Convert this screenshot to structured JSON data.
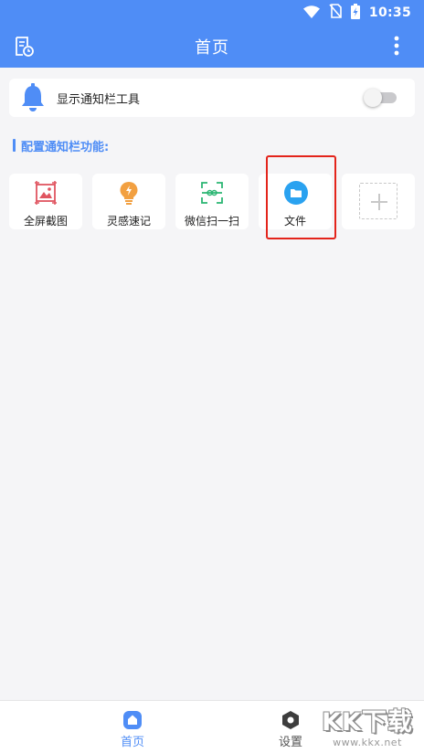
{
  "status_bar": {
    "time": "10:35",
    "icons": [
      "wifi-icon",
      "no-sim-icon",
      "battery-charging-icon"
    ]
  },
  "app_bar": {
    "title": "首页",
    "left_icon": "notes-clock-icon",
    "right_icon": "more-vertical-icon"
  },
  "notification_toggle": {
    "icon": "bell-icon",
    "label": "显示通知栏工具",
    "enabled": false
  },
  "section": {
    "title": "配置通知栏功能:"
  },
  "tools": [
    {
      "label": "全屏截图",
      "icon": "screenshot-image-icon",
      "color": "#e05560"
    },
    {
      "label": "灵感速记",
      "icon": "lightbulb-icon",
      "color": "#f2a041"
    },
    {
      "label": "微信扫一扫",
      "icon": "scan-icon",
      "color": "#2bb673"
    },
    {
      "label": "文件",
      "icon": "folder-icon",
      "color": "#2aa2f0"
    }
  ],
  "add_tool": {
    "icon": "plus-icon"
  },
  "bottom_nav": [
    {
      "label": "首页",
      "icon": "home-icon",
      "active": true
    },
    {
      "label": "设置",
      "icon": "settings-hexagon-icon",
      "active": false
    }
  ],
  "watermark": {
    "main": "KK下载",
    "sub": "www.kkx.net"
  },
  "colors": {
    "primary": "#4f8df6",
    "background": "#f5f5f7",
    "highlight_box": "#e3241b"
  }
}
